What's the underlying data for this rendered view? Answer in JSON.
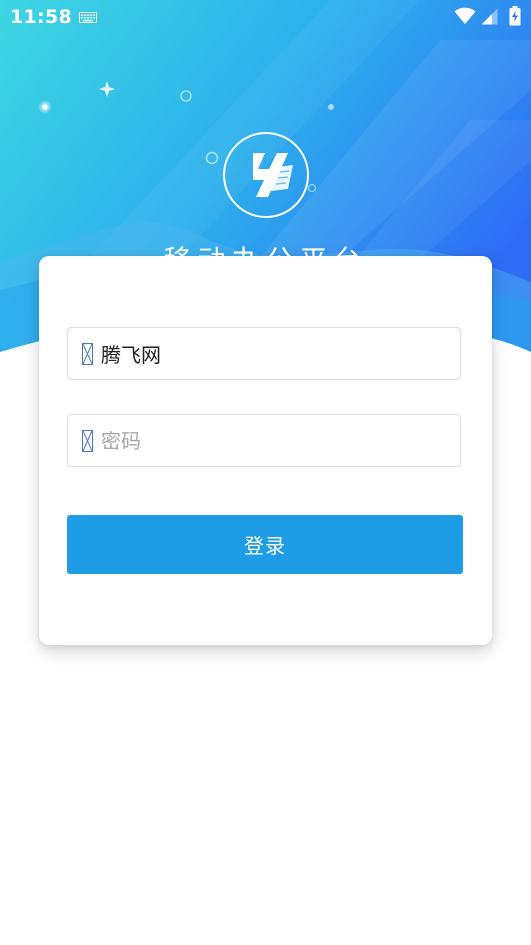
{
  "status_bar": {
    "time": "11:58",
    "icons": [
      "keyboard-icon",
      "wifi-icon",
      "cellular-signal-icon",
      "battery-charging-icon"
    ]
  },
  "header": {
    "logo_icon": "app-logo-icon",
    "title": "移动办公平台"
  },
  "login_form": {
    "username": {
      "icon": "user-icon",
      "value": "腾飞网",
      "placeholder": ""
    },
    "password": {
      "icon": "lock-icon",
      "value": "",
      "placeholder": "密码"
    },
    "submit_label": "登录"
  },
  "colors": {
    "gradient_start": "#3ed6e2",
    "gradient_end": "#2f6cf6",
    "button": "#1f9ce6",
    "field_border": "#dedede",
    "card_background": "#ffffff"
  }
}
